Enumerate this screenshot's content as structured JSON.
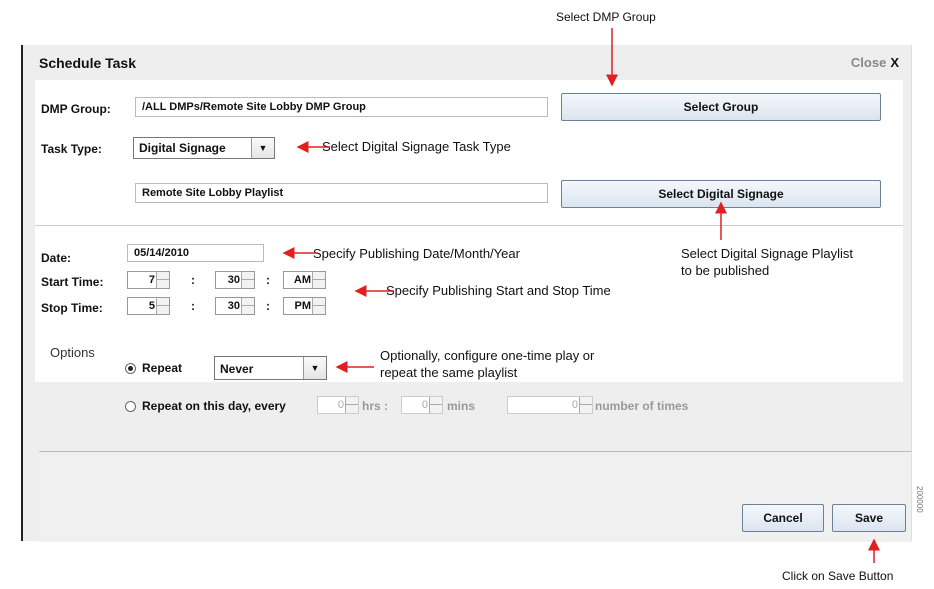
{
  "dialog": {
    "title": "Schedule Task",
    "close_label": "Close",
    "close_glyph": "X"
  },
  "dmp_group": {
    "label": "DMP Group:",
    "value": "/ALL DMPs/Remote Site Lobby DMP Group",
    "button": "Select Group"
  },
  "task_type": {
    "label": "Task Type:",
    "value": "Digital Signage"
  },
  "playlist": {
    "value": "Remote Site Lobby Playlist",
    "button": "Select Digital Signage"
  },
  "date": {
    "label": "Date:",
    "value": "05/14/2010"
  },
  "start_time": {
    "label": "Start Time:",
    "hour": "7",
    "minute": "30",
    "ampm": "AM"
  },
  "stop_time": {
    "label": "Stop Time:",
    "hour": "5",
    "minute": "30",
    "ampm": "PM"
  },
  "colon": ":",
  "options": {
    "label": "Options",
    "repeat_label": "Repeat",
    "repeat_value": "Never",
    "repeat_day_label": "Repeat on this day, every",
    "hrs_value": "0",
    "hrs_label": "hrs :",
    "mins_value": "0",
    "mins_label": "mins",
    "times_value": "0",
    "times_label": "number of times"
  },
  "footer": {
    "cancel": "Cancel",
    "save": "Save"
  },
  "annotations": {
    "select_group": "Select DMP Group",
    "task_type": "Select Digital Signage Task Type",
    "playlist_line1": "Select Digital Signage Playlist",
    "playlist_line2": "to be published",
    "date": "Specify Publishing Date/Month/Year",
    "time": "Specify Publishing Start and Stop Time",
    "options_line1": "Optionally, configure one-time play or",
    "options_line2": "repeat the same playlist",
    "save": "Click on Save Button"
  },
  "figure_id": "200000",
  "colors": {
    "arrow": "#e02020",
    "button_border": "#6f7f94",
    "panel": "#eeeeee"
  }
}
